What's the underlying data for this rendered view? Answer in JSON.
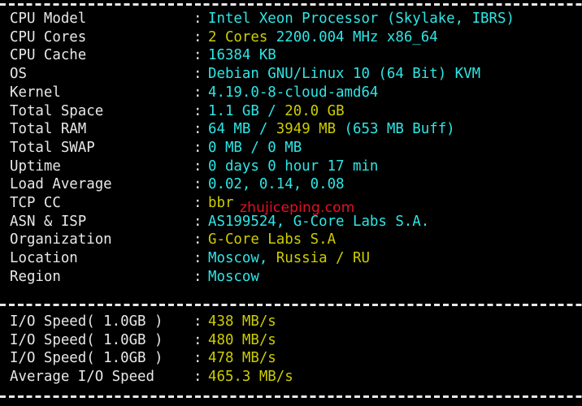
{
  "terminal": {
    "background_color": "#000000",
    "label_color": "#e8e8e8",
    "cyan_color": "#2ee6e6",
    "yellow_color": "#cdcd00",
    "watermark_color": "#e81123",
    "colon": ":",
    "separator_char": "-"
  },
  "watermark": {
    "text": "zhujiceping.com"
  },
  "system_info": [
    {
      "label": "CPU Model",
      "segments": [
        {
          "text": "Intel Xeon Processor (Skylake, IBRS)",
          "color": "cyan"
        }
      ]
    },
    {
      "label": "CPU Cores",
      "segments": [
        {
          "text": "2 Cores",
          "color": "yellow"
        },
        {
          "text": " 2200.004 MHz x86_64",
          "color": "cyan"
        }
      ]
    },
    {
      "label": "CPU Cache",
      "segments": [
        {
          "text": "16384 KB",
          "color": "cyan"
        }
      ]
    },
    {
      "label": "OS",
      "segments": [
        {
          "text": "Debian GNU/Linux 10 (64 Bit) KVM",
          "color": "cyan"
        }
      ]
    },
    {
      "label": "Kernel",
      "segments": [
        {
          "text": "4.19.0-8-cloud-amd64",
          "color": "cyan"
        }
      ]
    },
    {
      "label": "Total Space",
      "segments": [
        {
          "text": "1.1 GB ",
          "color": "cyan"
        },
        {
          "text": "/ ",
          "color": "cyan"
        },
        {
          "text": "20.0 GB",
          "color": "yellow"
        }
      ]
    },
    {
      "label": "Total RAM",
      "segments": [
        {
          "text": "64 MB ",
          "color": "cyan"
        },
        {
          "text": "/ ",
          "color": "cyan"
        },
        {
          "text": "3949 MB ",
          "color": "yellow"
        },
        {
          "text": "(653 MB Buff)",
          "color": "cyan"
        }
      ]
    },
    {
      "label": "Total SWAP",
      "segments": [
        {
          "text": "0 MB / 0 MB",
          "color": "cyan"
        }
      ]
    },
    {
      "label": "Uptime",
      "segments": [
        {
          "text": "0 days 0 hour 17 min",
          "color": "cyan"
        }
      ]
    },
    {
      "label": "Load Average",
      "segments": [
        {
          "text": "0.02, 0.14, 0.08",
          "color": "cyan"
        }
      ]
    },
    {
      "label": "TCP CC",
      "segments": [
        {
          "text": "bbr",
          "color": "yellow"
        }
      ]
    },
    {
      "label": "ASN & ISP",
      "segments": [
        {
          "text": "AS199524, G-Core Labs S.A.",
          "color": "cyan"
        }
      ]
    },
    {
      "label": "Organization",
      "segments": [
        {
          "text": "G-Core Labs S.A",
          "color": "yellow"
        }
      ]
    },
    {
      "label": "Location",
      "segments": [
        {
          "text": "Moscow, ",
          "color": "cyan"
        },
        {
          "text": "Russia / RU",
          "color": "yellow"
        }
      ]
    },
    {
      "label": "Region",
      "segments": [
        {
          "text": "Moscow",
          "color": "cyan"
        }
      ]
    }
  ],
  "io_results": [
    {
      "label": "I/O Speed( 1.0GB )",
      "segments": [
        {
          "text": "438 MB/s",
          "color": "yellow"
        }
      ]
    },
    {
      "label": "I/O Speed( 1.0GB )",
      "segments": [
        {
          "text": "480 MB/s",
          "color": "yellow"
        }
      ]
    },
    {
      "label": "I/O Speed( 1.0GB )",
      "segments": [
        {
          "text": "478 MB/s",
          "color": "yellow"
        }
      ]
    },
    {
      "label": "Average I/O Speed",
      "segments": [
        {
          "text": "465.3 MB/s",
          "color": "yellow"
        }
      ]
    }
  ]
}
